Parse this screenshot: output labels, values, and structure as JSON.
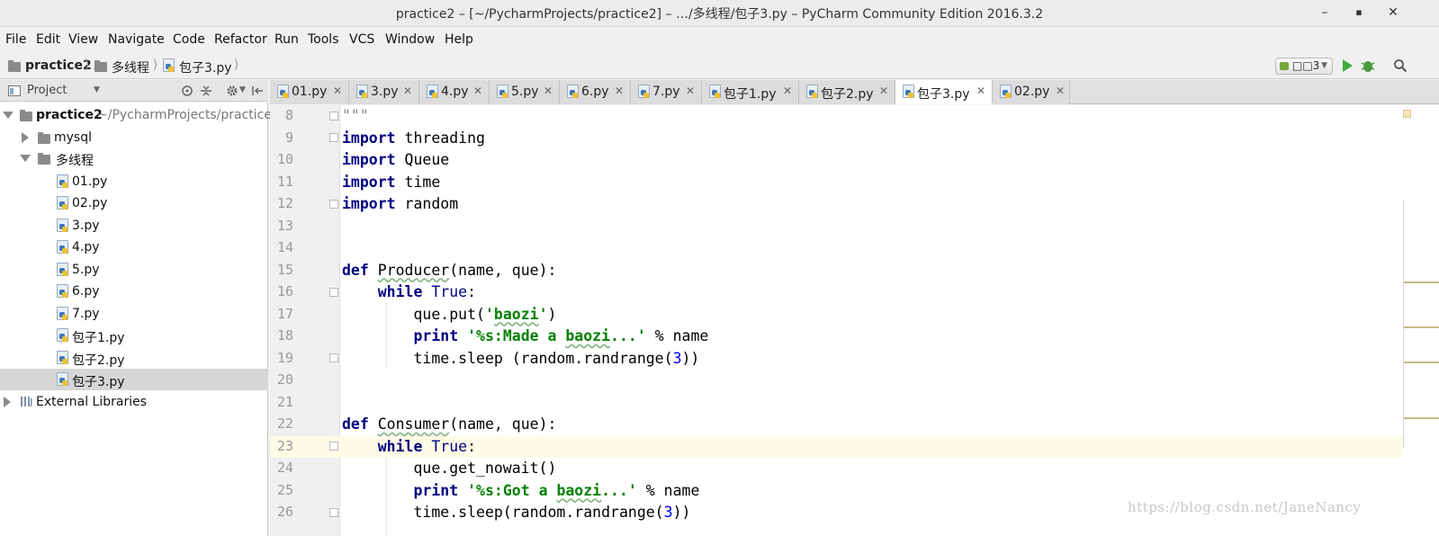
{
  "window": {
    "title": "practice2 – [~/PycharmProjects/practice2] – …/多线程/包子3.py – PyCharm Community Edition 2016.3.2",
    "minimize": "–",
    "maximize": "▪",
    "close": "✕"
  },
  "menu": [
    "File",
    "Edit",
    "View",
    "Navigate",
    "Code",
    "Refactor",
    "Run",
    "Tools",
    "VCS",
    "Window",
    "Help"
  ],
  "breadcrumb": [
    "practice2",
    "多线程",
    "包子3.py"
  ],
  "run_config": "□□3",
  "project_panel": {
    "title": "Project",
    "root_name": "practice2",
    "root_path": "~/PycharmProjects/practice2",
    "folders": [
      "mysql",
      "多线程"
    ],
    "files": [
      "01.py",
      "02.py",
      "3.py",
      "4.py",
      "5.py",
      "6.py",
      "7.py",
      "包子1.py",
      "包子2.py",
      "包子3.py"
    ],
    "external": "External Libraries"
  },
  "tabs": [
    "01.py",
    "3.py",
    "4.py",
    "5.py",
    "6.py",
    "7.py",
    "包子1.py",
    "包子2.py",
    "包子3.py",
    "02.py"
  ],
  "active_tab": "包子3.py",
  "editor": {
    "line_numbers": [
      "8",
      "9",
      "10",
      "11",
      "12",
      "13",
      "14",
      "15",
      "16",
      "17",
      "18",
      "19",
      "20",
      "21",
      "22",
      "23",
      "24",
      "25",
      "26"
    ],
    "current_line": "23"
  },
  "watermark": "https://blog.csdn.net/JaneNancy",
  "colors": {
    "keyword": "#000080",
    "string": "#008000",
    "number": "#0000ff",
    "current_line": "#fefbe6",
    "selection": "#d6d6d6"
  }
}
